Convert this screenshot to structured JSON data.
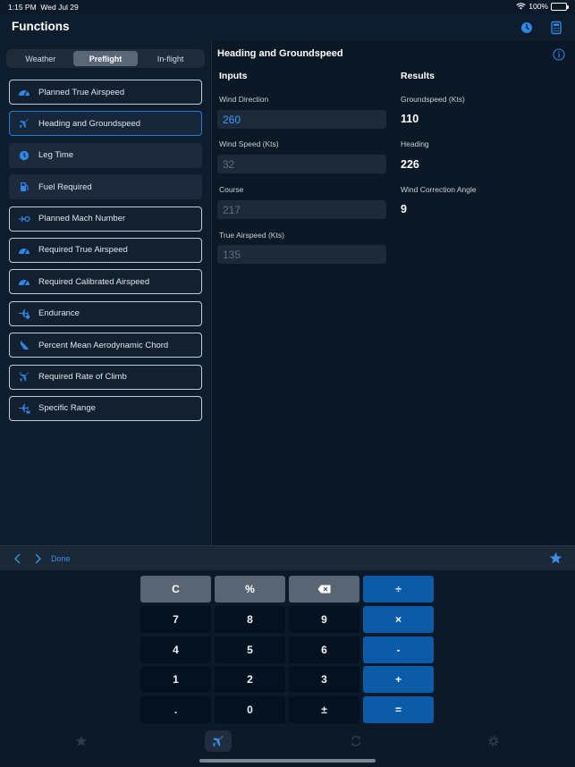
{
  "status": {
    "time": "1:15 PM",
    "date": "Wed Jul 29",
    "battery": "100%"
  },
  "nav": {
    "title": "Functions",
    "clock_icon": "clock-icon",
    "calculator_icon": "calculator-icon"
  },
  "segments": [
    {
      "label": "Weather"
    },
    {
      "label": "Preflight",
      "active": true
    },
    {
      "label": "In-flight"
    }
  ],
  "functions": [
    {
      "label": "Planned True Airspeed",
      "icon": "airspeed-gauge-icon"
    },
    {
      "label": "Heading and Groundspeed",
      "icon": "plane-heading-icon",
      "selected": true
    },
    {
      "label": "Leg Time",
      "icon": "clock-icon",
      "filled": true
    },
    {
      "label": "Fuel Required",
      "icon": "fuel-pump-icon",
      "filled": true
    },
    {
      "label": "Planned Mach Number",
      "icon": "mach-icon"
    },
    {
      "label": "Required True Airspeed",
      "icon": "airspeed-gauge-icon"
    },
    {
      "label": "Required Calibrated Airspeed",
      "icon": "airspeed-gauge-icon"
    },
    {
      "label": "Endurance",
      "icon": "plane-clock-icon"
    },
    {
      "label": "Percent Mean Aerodynamic Chord",
      "icon": "wing-icon"
    },
    {
      "label": "Required Rate of Climb",
      "icon": "plane-climb-icon"
    },
    {
      "label": "Specific Range",
      "icon": "plane-range-icon"
    }
  ],
  "detail": {
    "title": "Heading and Groundspeed",
    "inputs_header": "Inputs",
    "results_header": "Results",
    "inputs": [
      {
        "label": "Wind Direction",
        "value": "260",
        "active": true
      },
      {
        "label": "Wind Speed (Kts)",
        "value": "32"
      },
      {
        "label": "Course",
        "value": "217"
      },
      {
        "label": "True Airspeed (Kts)",
        "value": "135"
      }
    ],
    "results": [
      {
        "label": "Groundspeed (Kts)",
        "value": "110"
      },
      {
        "label": "Heading",
        "value": "226"
      },
      {
        "label": "Wind Correction Angle",
        "value": "9"
      }
    ]
  },
  "toolbar": {
    "done": "Done"
  },
  "keypad": {
    "rows": [
      [
        "C",
        "%",
        "⌫",
        "÷"
      ],
      [
        "7",
        "8",
        "9",
        "×"
      ],
      [
        "4",
        "5",
        "6",
        "-"
      ],
      [
        "1",
        "2",
        "3",
        "+"
      ],
      [
        ".",
        "0",
        "±",
        "="
      ]
    ]
  },
  "colors": {
    "accent": "#3b8fe8",
    "operator": "#0b5ba8",
    "function_key": "#5a6574",
    "background": "#0c1928"
  }
}
